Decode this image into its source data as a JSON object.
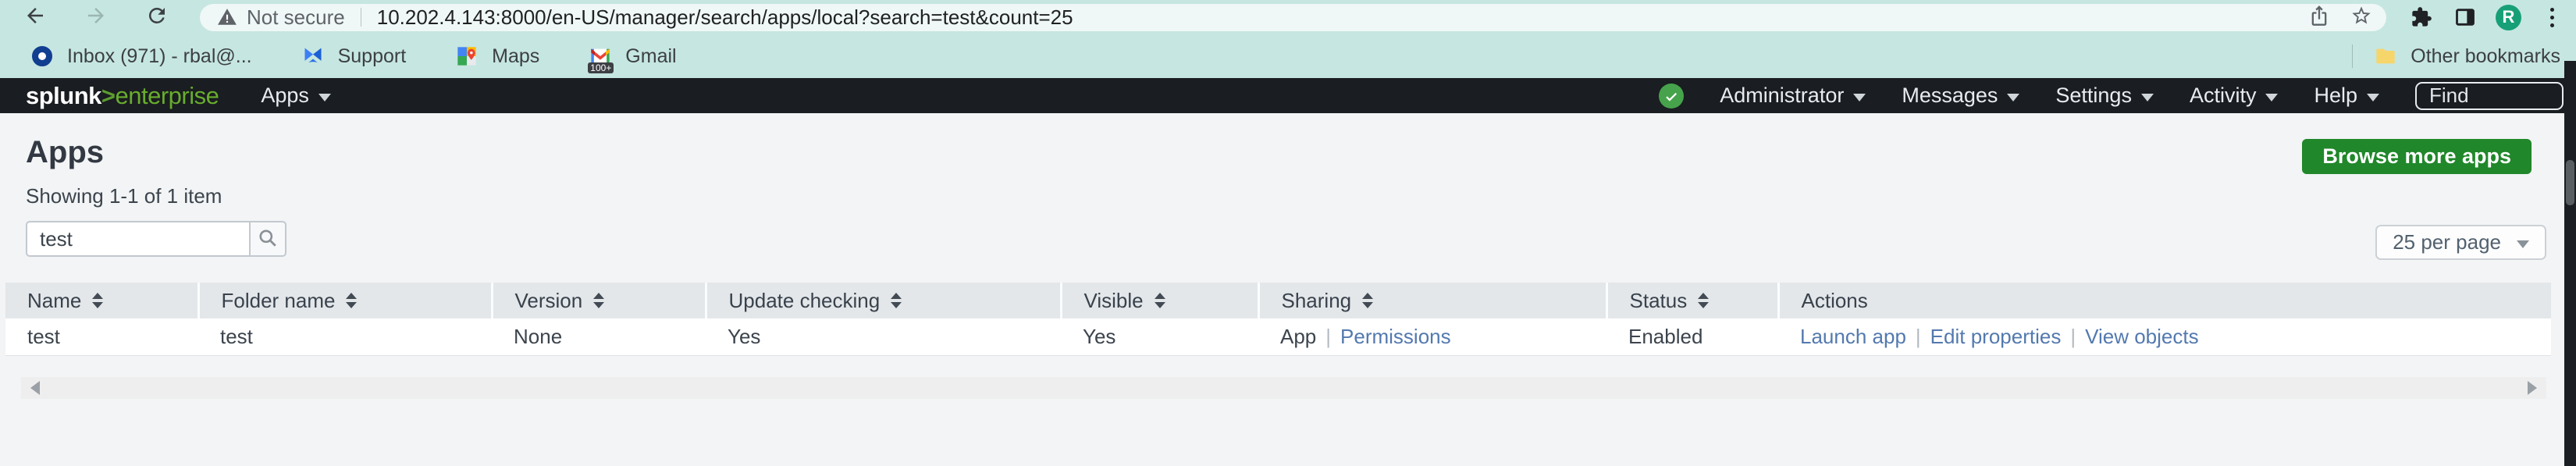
{
  "browser": {
    "security_label": "Not secure",
    "url": "10.202.4.143:8000/en-US/manager/search/apps/local?search=test&count=25",
    "avatar_initial": "R",
    "bookmarks": [
      {
        "label": "Inbox (971) - rbal@...",
        "icon": "outlook-icon"
      },
      {
        "label": "Support",
        "icon": "support-icon"
      },
      {
        "label": "Maps",
        "icon": "maps-icon"
      },
      {
        "label": "Gmail",
        "icon": "gmail-icon",
        "badge": "100+"
      }
    ],
    "other_bookmarks_label": "Other bookmarks"
  },
  "nav": {
    "logo": {
      "brand": "splunk",
      "gt": ">",
      "product": "enterprise"
    },
    "apps_menu_label": "Apps",
    "menus": [
      {
        "label": "Administrator"
      },
      {
        "label": "Messages"
      },
      {
        "label": "Settings"
      },
      {
        "label": "Activity"
      },
      {
        "label": "Help"
      }
    ],
    "find_placeholder": "Find"
  },
  "page": {
    "title": "Apps",
    "count_text": "Showing 1-1 of 1 item",
    "search_value": "test",
    "browse_button_label": "Browse more apps",
    "per_page_label": "25 per page"
  },
  "table": {
    "columns": [
      {
        "label": "Name",
        "sortable": true
      },
      {
        "label": "Folder name",
        "sortable": true
      },
      {
        "label": "Version",
        "sortable": true
      },
      {
        "label": "Update checking",
        "sortable": true
      },
      {
        "label": "Visible",
        "sortable": true
      },
      {
        "label": "Sharing",
        "sortable": true
      },
      {
        "label": "Status",
        "sortable": true
      },
      {
        "label": "Actions",
        "sortable": false
      }
    ],
    "row": {
      "name": "test",
      "folder_name": "test",
      "version": "None",
      "update_checking": "Yes",
      "visible": "Yes",
      "sharing_type": "App",
      "sharing_link": "Permissions",
      "status": "Enabled",
      "actions": [
        "Launch app",
        "Edit properties",
        "View objects"
      ]
    }
  },
  "colors": {
    "splunk_green": "#65a637",
    "button_green": "#20872a",
    "link_blue": "#5379af",
    "toolbar_teal": "#c6e6e1",
    "navbar_dark": "#1a1d21"
  }
}
